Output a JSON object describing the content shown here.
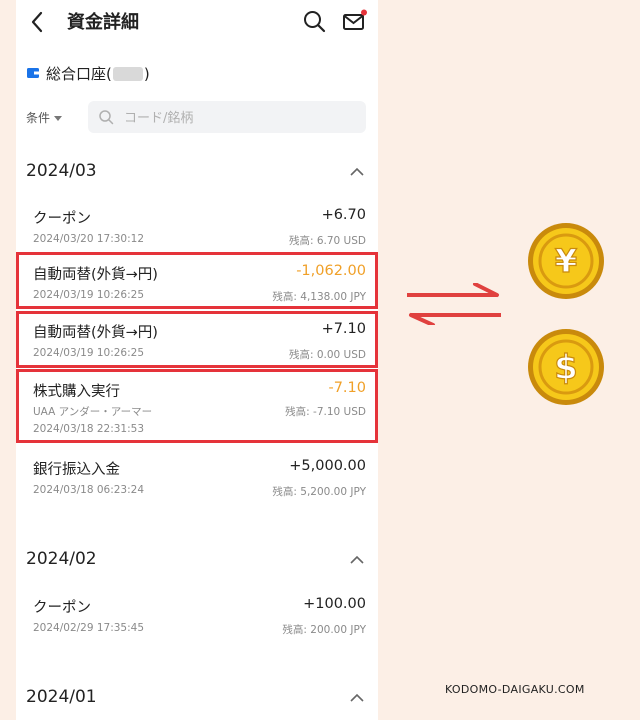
{
  "header": {
    "title": "資金詳細"
  },
  "account": {
    "label": "総合口座(",
    "label_end": ")"
  },
  "filter": {
    "label": "条件"
  },
  "search": {
    "placeholder": "コード/銘柄"
  },
  "sections": [
    {
      "month": "2024/03",
      "transactions": [
        {
          "title": "クーポン",
          "amount": "+6.70",
          "date": "2024/03/20 17:30:12",
          "balance": "残高: 6.70 USD"
        },
        {
          "title": "自動両替(外貨→円)",
          "amount": "-1,062.00",
          "date": "2024/03/19 10:26:25",
          "balance": "残高: 4,138.00 JPY",
          "highlighted": true
        },
        {
          "title": "自動両替(外貨→円)",
          "amount": "+7.10",
          "date": "2024/03/19 10:26:25",
          "balance": "残高: 0.00 USD",
          "highlighted": true
        },
        {
          "title": "株式購入実行",
          "subtitle": "UAA アンダー・アーマー",
          "amount": "-7.10",
          "date": "2024/03/18 22:31:53",
          "balance": "残高: -7.10 USD",
          "highlighted": true
        },
        {
          "title": "銀行振込入金",
          "amount": "+5,000.00",
          "date": "2024/03/18 06:23:24",
          "balance": "残高: 5,200.00 JPY"
        }
      ]
    },
    {
      "month": "2024/02",
      "transactions": [
        {
          "title": "クーポン",
          "amount": "+100.00",
          "date": "2024/02/29 17:35:45",
          "balance": "残高: 200.00 JPY"
        }
      ]
    },
    {
      "month": "2024/01",
      "transactions": []
    }
  ],
  "illustration": {
    "yen_symbol": "¥",
    "dollar_symbol": "$"
  },
  "watermark": "KODOMO-DAIGAKU.COM",
  "colors": {
    "highlight": "#e5333a",
    "negative_amount": "#f0a028",
    "background": "#fcefe6",
    "coin": "#f6c81a"
  }
}
